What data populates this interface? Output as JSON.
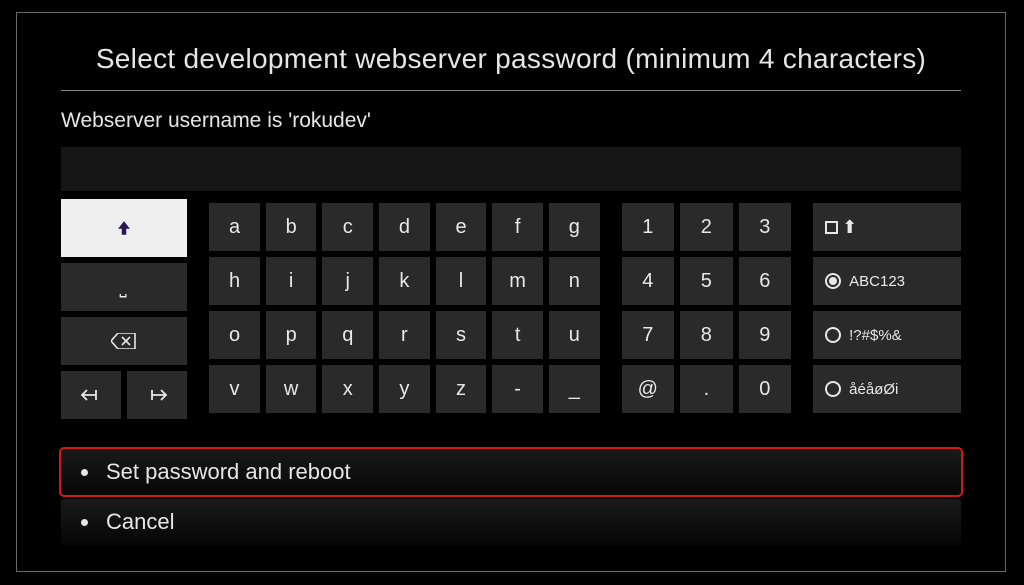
{
  "title": "Select development webserver password (minimum 4 characters)",
  "sublabel": "Webserver username is 'rokudev'",
  "input_value": "",
  "keys": {
    "letters": [
      [
        "a",
        "b",
        "c",
        "d",
        "e",
        "f",
        "g"
      ],
      [
        "h",
        "i",
        "j",
        "k",
        "l",
        "m",
        "n"
      ],
      [
        "o",
        "p",
        "q",
        "r",
        "s",
        "t",
        "u"
      ],
      [
        "v",
        "w",
        "x",
        "y",
        "z",
        "-",
        "_"
      ]
    ],
    "numpad": [
      [
        "1",
        "2",
        "3"
      ],
      [
        "4",
        "5",
        "6"
      ],
      [
        "7",
        "8",
        "9"
      ],
      [
        "@",
        ".",
        "0"
      ]
    ],
    "modes": {
      "abc": "ABC123",
      "sym": "!?#$%&",
      "intl": "åéåøØi"
    }
  },
  "options": {
    "set": "Set password and reboot",
    "cancel": "Cancel"
  }
}
